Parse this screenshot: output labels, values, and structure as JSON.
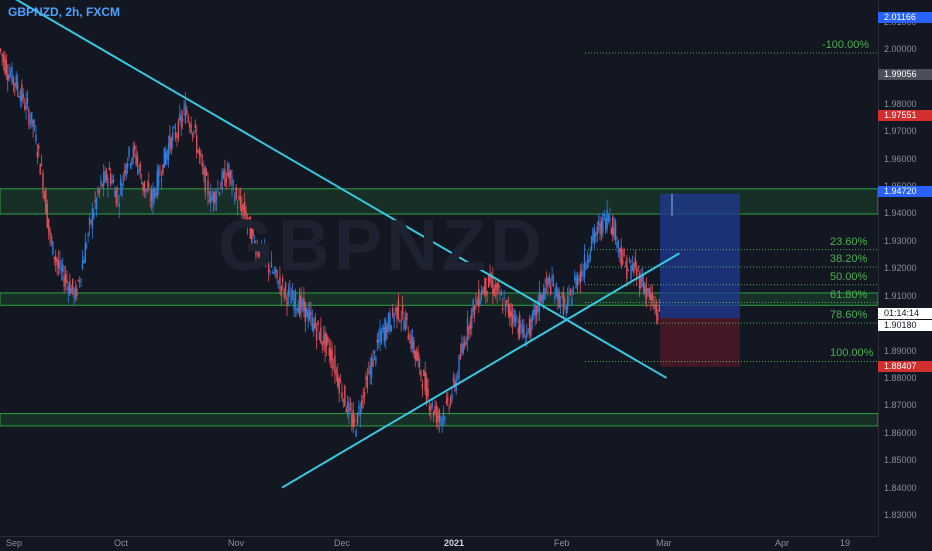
{
  "symbol": {
    "title": "GBPNZD, 2h, FXCM",
    "watermark": "GBPNZD"
  },
  "colors": {
    "background": "#131722",
    "candle_up": "#2f7de1",
    "candle_down": "#e0505a",
    "trendline": "#38c8e0",
    "zone": "#2ea043",
    "fib": "#4caf50",
    "target_zone": "#1f3a93",
    "stop_zone": "#5a1a26",
    "tag_blue": "#2962ff",
    "tag_red": "#d32f2f",
    "tag_grey": "#4b4f5c",
    "tag_white": "#ffffff"
  },
  "y_axis": {
    "labels": [
      "1.83000",
      "1.84000",
      "1.85000",
      "1.86000",
      "1.87000",
      "1.88000",
      "1.89000",
      "1.90000",
      "1.91000",
      "1.92000",
      "1.93000",
      "1.94000",
      "1.95000",
      "1.96000",
      "1.97000",
      "1.98000",
      "1.99000",
      "2.00000",
      "2.01000"
    ]
  },
  "price_tags": {
    "top": "2.01166",
    "grey": "1.99056",
    "red_upper": "1.97551",
    "blue": "1.94720",
    "countdown": "01:14:14",
    "current": "1.90180",
    "red_lower": "1.88407"
  },
  "x_axis": {
    "labels": [
      {
        "text": "Sep",
        "bold": false
      },
      {
        "text": "Oct",
        "bold": false
      },
      {
        "text": "Nov",
        "bold": false
      },
      {
        "text": "Dec",
        "bold": false
      },
      {
        "text": "2021",
        "bold": true
      },
      {
        "text": "Feb",
        "bold": false
      },
      {
        "text": "Mar",
        "bold": false
      },
      {
        "text": "Apr",
        "bold": false
      },
      {
        "text": "19",
        "bold": false
      }
    ]
  },
  "fib_levels": [
    {
      "label": "-100.00%",
      "price": 1.9985
    },
    {
      "label": "23.60%",
      "price": 1.9268
    },
    {
      "label": "38.20%",
      "price": 1.9205
    },
    {
      "label": "50.00%",
      "price": 1.914
    },
    {
      "label": "61.80%",
      "price": 1.9075
    },
    {
      "label": "78.60%",
      "price": 1.9
    },
    {
      "label": "100.00%",
      "price": 1.886
    }
  ],
  "zones": [
    {
      "name": "resistance-zone",
      "from": 1.9398,
      "to": 1.949
    },
    {
      "name": "mid-zone",
      "from": 1.9065,
      "to": 1.911
    },
    {
      "name": "support-zone",
      "from": 1.8625,
      "to": 1.867
    }
  ],
  "trendlines": [
    {
      "name": "descending",
      "from": {
        "t": 0,
        "p": 2.0215
      },
      "to": {
        "t": 1.55,
        "p": 1.88
      }
    },
    {
      "name": "ascending",
      "from": {
        "t": 0.656,
        "p": 1.84
      },
      "to": {
        "t": 1.58,
        "p": 1.9255
      }
    }
  ],
  "trade_box": {
    "entry": 1.9018,
    "target": 1.9472,
    "stop": 1.8841
  },
  "price_series": [
    2.0,
    1.992,
    1.987,
    1.98,
    1.972,
    1.955,
    1.93,
    1.92,
    1.915,
    1.91,
    1.925,
    1.94,
    1.95,
    1.955,
    1.945,
    1.96,
    1.962,
    1.95,
    1.945,
    1.955,
    1.965,
    1.97,
    1.978,
    1.97,
    1.955,
    1.945,
    1.95,
    1.955,
    1.945,
    1.94,
    1.93,
    1.925,
    1.92,
    1.915,
    1.91,
    1.908,
    1.905,
    1.9,
    1.895,
    1.89,
    1.88,
    1.87,
    1.862,
    1.875,
    1.885,
    1.895,
    1.9,
    1.905,
    1.9,
    1.89,
    1.88,
    1.87,
    1.865,
    1.87,
    1.88,
    1.895,
    1.905,
    1.912,
    1.915,
    1.91,
    1.905,
    1.902,
    1.895,
    1.9,
    1.91,
    1.915,
    1.91,
    1.905,
    1.915,
    1.92,
    1.93,
    1.935,
    1.94,
    1.93,
    1.92,
    1.92,
    1.915,
    1.908,
    1.902
  ]
}
